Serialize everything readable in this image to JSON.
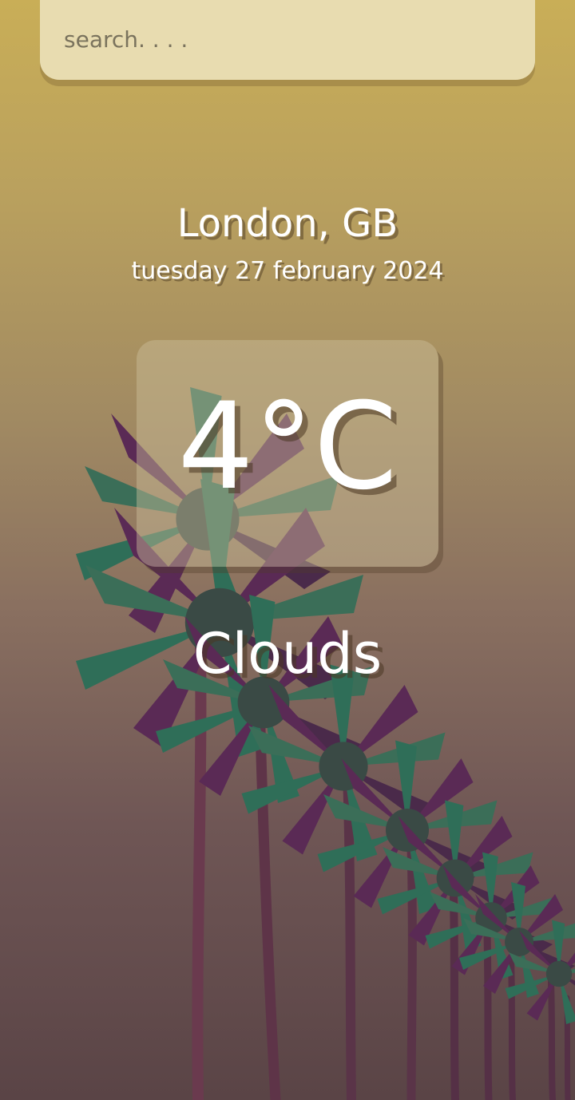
{
  "search": {
    "placeholder": "search. . . ."
  },
  "location": {
    "city_country": "London, GB"
  },
  "date": {
    "text": "tuesday 27 february 2024"
  },
  "weather": {
    "temperature": "4°C",
    "condition": "Clouds"
  },
  "background": {
    "image": "palm-trees-photo",
    "colors": {
      "top": "#c9ae57",
      "bottom": "#5a4446",
      "frond_green": "#2f6e58",
      "frond_purple": "#5a2a55"
    }
  }
}
